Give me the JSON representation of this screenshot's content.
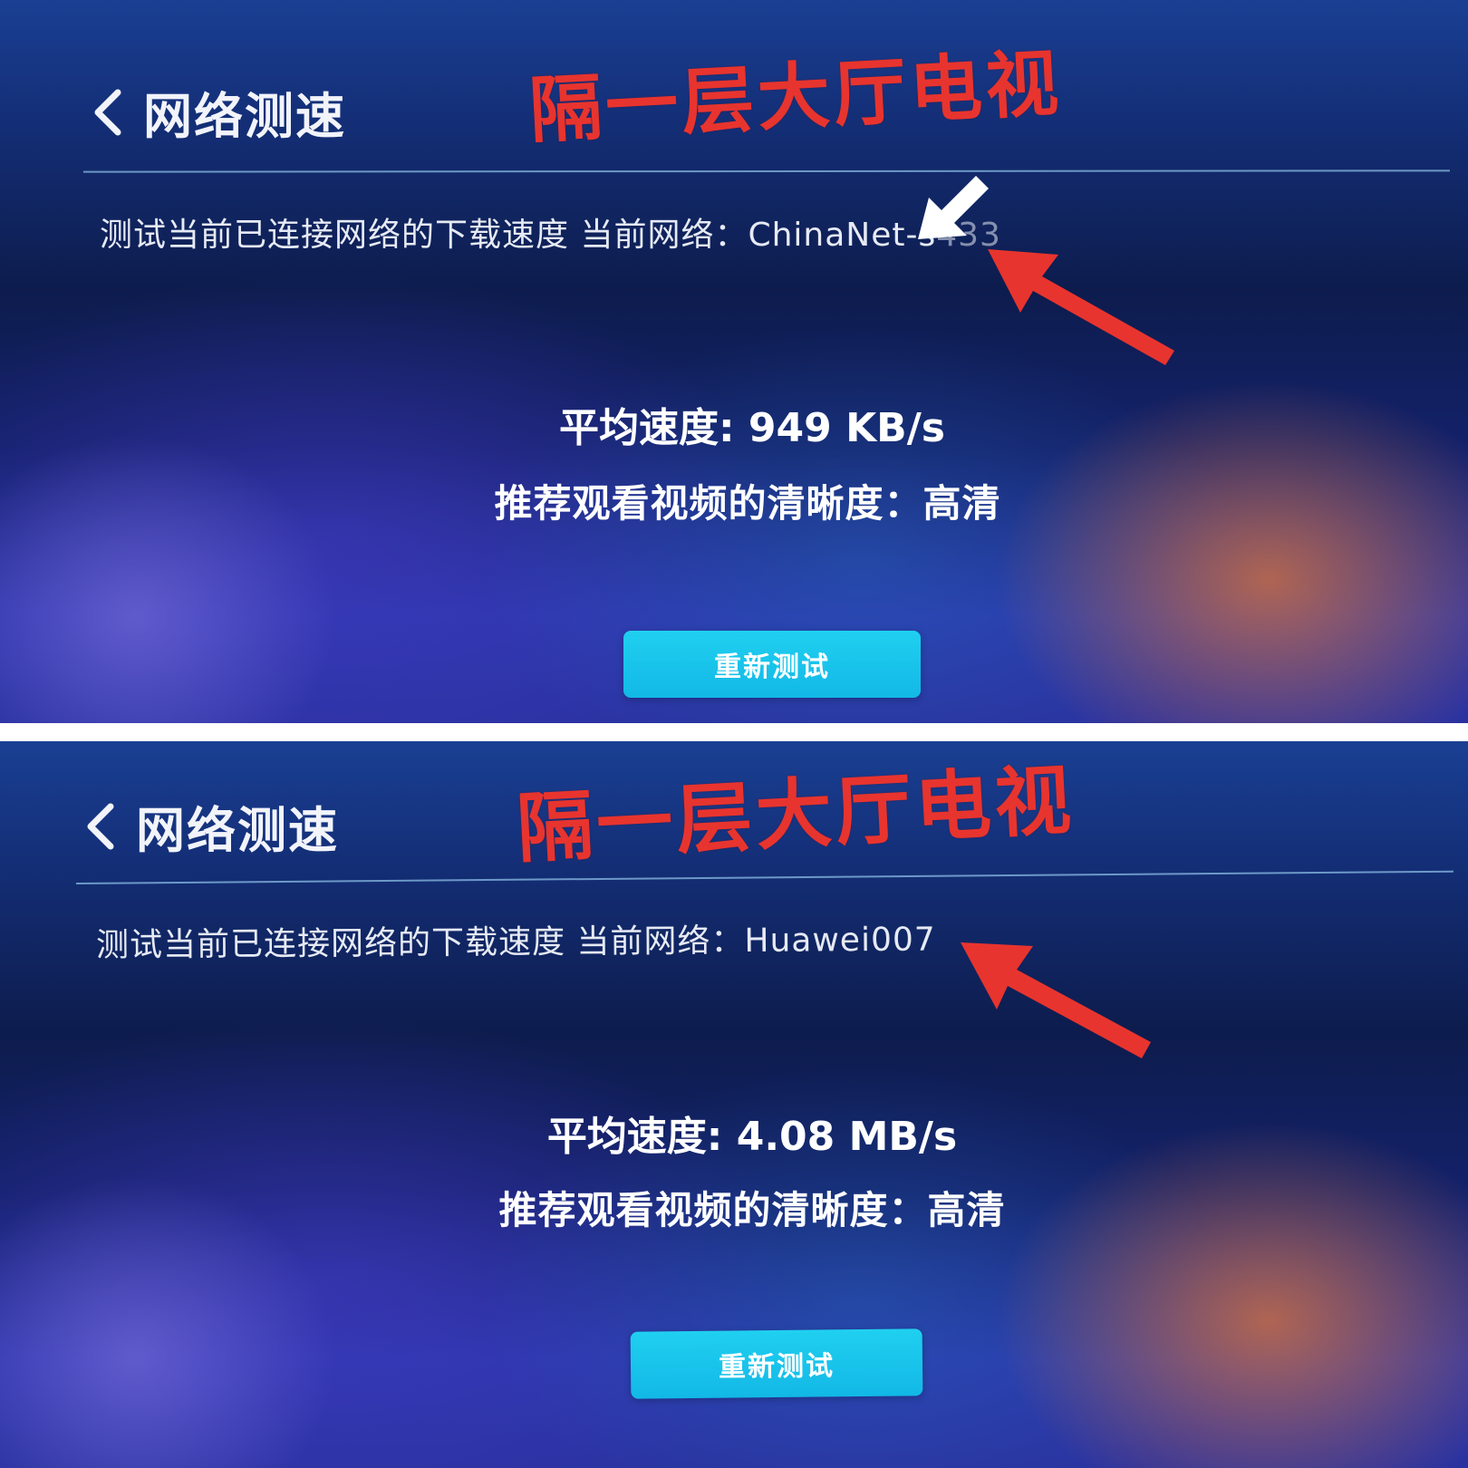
{
  "panels": [
    {
      "title": "网络测速",
      "caption": "隔一层大厅电视",
      "network_prefix": "测试当前已连接网络的下载速度 当前网络：",
      "network_name": "ChinaNet-s",
      "network_name_obscured": "433",
      "average_speed": "平均速度: 949 KB/s",
      "recommendation": "推荐观看视频的清晰度：高清",
      "retest_label": "重新测试"
    },
    {
      "title": "网络测速",
      "caption": "隔一层大厅电视",
      "network_prefix": "测试当前已连接网络的下载速度 当前网络：",
      "network_name": "Huawei007",
      "average_speed": "平均速度: 4.08 MB/s",
      "recommendation": "推荐观看视频的清晰度：高清",
      "retest_label": "重新测试"
    }
  ],
  "icons": {
    "back": "chevron-left-icon",
    "annotation_arrow": "red-arrow-icon",
    "pointer_arrow": "white-arrow-icon"
  },
  "colors": {
    "caption_red": "#e8342e",
    "button_cyan": "#14bfe8",
    "divider": "#8cbee6"
  }
}
